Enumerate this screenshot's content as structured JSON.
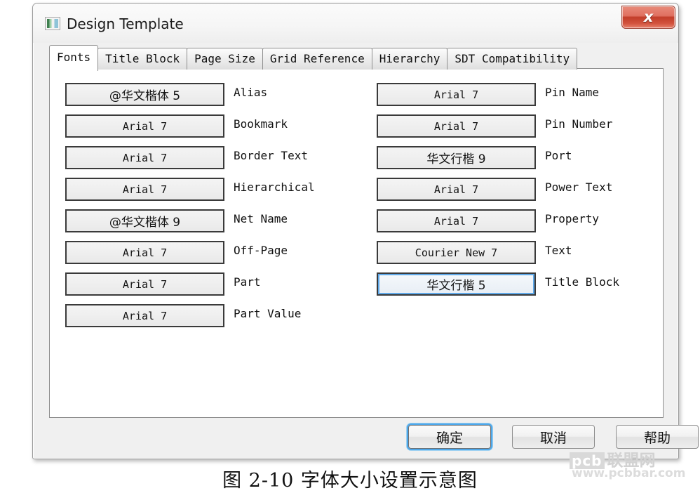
{
  "window": {
    "title": "Design Template",
    "icon": "image-template-icon",
    "close_label": "x"
  },
  "tabs": [
    {
      "label": "Fonts",
      "active": true
    },
    {
      "label": "Title Block",
      "active": false
    },
    {
      "label": "Page Size",
      "active": false
    },
    {
      "label": "Grid Reference",
      "active": false
    },
    {
      "label": "Hierarchy",
      "active": false
    },
    {
      "label": "SDT Compatibility",
      "active": false
    }
  ],
  "fonts": {
    "left_column": [
      {
        "value": "@华文楷体 5",
        "cjk": true,
        "label": "Alias",
        "underline_index": -1,
        "focused": false
      },
      {
        "value": "Arial 7",
        "cjk": false,
        "label": "Bookmark",
        "underline_index": -1,
        "focused": false
      },
      {
        "value": "Arial 7",
        "cjk": false,
        "label": "Border Text",
        "underline_index": -1,
        "focused": false
      },
      {
        "value": "Arial 7",
        "cjk": false,
        "label": "Hierarchical",
        "underline_index": -1,
        "focused": false
      },
      {
        "value": "@华文楷体 9",
        "cjk": true,
        "label": "Net Name",
        "underline_index": -1,
        "focused": false
      },
      {
        "value": "Arial 7",
        "cjk": false,
        "label": "Off-Page",
        "underline_index": -1,
        "focused": false
      },
      {
        "value": "Arial 7",
        "cjk": false,
        "label": "Part",
        "underline_index": -1,
        "focused": false
      },
      {
        "value": "Arial 7",
        "cjk": false,
        "label": "Part Value",
        "underline_index": -1,
        "focused": false
      }
    ],
    "right_column": [
      {
        "value": "Arial 7",
        "cjk": false,
        "label": "Pin Name",
        "underline_index": -1,
        "focused": false
      },
      {
        "value": "Arial 7",
        "cjk": false,
        "label": "Pin Number",
        "underline_index": -1,
        "focused": false
      },
      {
        "value": "华文行楷 9",
        "cjk": true,
        "label": "Port",
        "underline_index": -1,
        "focused": false
      },
      {
        "value": "Arial 7",
        "cjk": false,
        "label": "Power Text",
        "underline_index": -1,
        "focused": false
      },
      {
        "value": "Arial 7",
        "cjk": false,
        "label": "Property",
        "underline_index": -1,
        "focused": false
      },
      {
        "value": "Courier New 7",
        "cjk": false,
        "label": "Text",
        "underline_index": -1,
        "focused": false
      },
      {
        "value": "华文行楷 5",
        "cjk": true,
        "label": "Title Block",
        "underline_index": -1,
        "focused": true
      }
    ]
  },
  "buttons": {
    "ok": "确定",
    "cancel": "取消",
    "help": "帮助"
  },
  "caption": "图 2-10  字体大小设置示意图",
  "watermark": {
    "brand": "pcb",
    "brand_cn": "联盟网",
    "url": "www.pcbbar.com"
  },
  "colors": {
    "focus_blue": "#4da6e8",
    "close_red": "#c13d29",
    "dialog_bg": "#f0f0f0",
    "panel_bg": "#ffffff"
  }
}
